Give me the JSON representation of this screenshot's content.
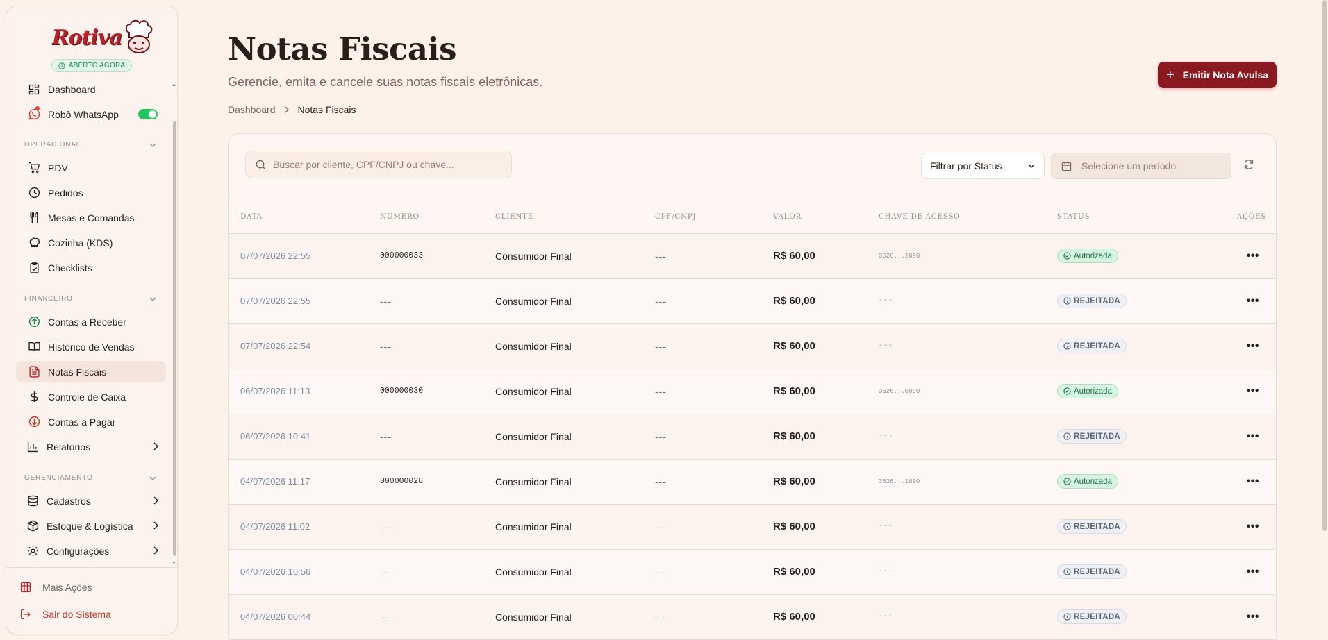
{
  "brand": {
    "logo_text": "Rotiva",
    "open_badge": "ABERTO AGORA",
    "brand_color": "#b5232a"
  },
  "sidebar": {
    "top_items": [
      {
        "label": "Dashboard",
        "icon": "dashboard-icon"
      },
      {
        "label": "Robô WhatsApp",
        "icon": "whatsapp-icon",
        "toggle_on": true
      }
    ],
    "sections": [
      {
        "title": "OPERACIONAL",
        "items": [
          {
            "label": "PDV",
            "icon": "cart-icon"
          },
          {
            "label": "Pedidos",
            "icon": "clock-icon"
          },
          {
            "label": "Mesas e Comandas",
            "icon": "utensils-icon"
          },
          {
            "label": "Cozinha (KDS)",
            "icon": "chef-hat-icon"
          },
          {
            "label": "Checklists",
            "icon": "clipboard-check-icon"
          }
        ]
      },
      {
        "title": "FINANCEIRO",
        "items": [
          {
            "label": "Contas a Receber",
            "icon": "arrow-up-circle-icon"
          },
          {
            "label": "Histórico de Vendas",
            "icon": "book-icon"
          },
          {
            "label": "Notas Fiscais",
            "icon": "file-text-icon",
            "active": true
          },
          {
            "label": "Controle de Caixa",
            "icon": "dollar-icon"
          },
          {
            "label": "Contas a Pagar",
            "icon": "arrow-down-circle-icon"
          },
          {
            "label": "Relatórios",
            "icon": "bar-chart-icon",
            "has_submenu": true
          }
        ]
      },
      {
        "title": "GERENCIAMENTO",
        "items": [
          {
            "label": "Cadastros",
            "icon": "database-icon",
            "has_submenu": true
          },
          {
            "label": "Estoque & Logística",
            "icon": "package-icon",
            "has_submenu": true
          },
          {
            "label": "Configurações",
            "icon": "gear-icon",
            "has_submenu": true
          }
        ]
      }
    ],
    "footer": {
      "more_actions": "Mais Ações",
      "logout": "Sair do Sistema"
    }
  },
  "header": {
    "title": "Notas Fiscais",
    "subtitle": "Gerencie, emita e cancele suas notas fiscais eletrônicas.",
    "breadcrumb": [
      "Dashboard",
      "Notas Fiscais"
    ],
    "emit_button": "Emitir Nota Avulsa"
  },
  "toolbar": {
    "search_placeholder": "Buscar por cliente, CPF/CNPJ ou chave...",
    "status_filter": "Filtrar por Status",
    "date_placeholder": "Selecione um período"
  },
  "table": {
    "columns": [
      "DATA",
      "NÚMERO",
      "CLIENTE",
      "CPF/CNPJ",
      "VALOR",
      "CHAVE DE ACESSO",
      "STATUS",
      "AÇÕES"
    ],
    "rows": [
      {
        "data": "07/07/2026 22:55",
        "numero": "000000033",
        "cliente": "Consumidor Final",
        "cpf": "---",
        "valor": "R$ 60,00",
        "chave": "3526...2090",
        "status": "Autorizada"
      },
      {
        "data": "07/07/2026 22:55",
        "numero": "---",
        "cliente": "Consumidor Final",
        "cpf": "---",
        "valor": "R$ 60,00",
        "chave": "---",
        "status": "REJEITADA"
      },
      {
        "data": "07/07/2026 22:54",
        "numero": "---",
        "cliente": "Consumidor Final",
        "cpf": "---",
        "valor": "R$ 60,00",
        "chave": "---",
        "status": "REJEITADA"
      },
      {
        "data": "06/07/2026 11:13",
        "numero": "000000030",
        "cliente": "Consumidor Final",
        "cpf": "---",
        "valor": "R$ 60,00",
        "chave": "3526...0090",
        "status": "Autorizada"
      },
      {
        "data": "06/07/2026 10:41",
        "numero": "---",
        "cliente": "Consumidor Final",
        "cpf": "---",
        "valor": "R$ 60,00",
        "chave": "---",
        "status": "REJEITADA"
      },
      {
        "data": "04/07/2026 11:17",
        "numero": "000000028",
        "cliente": "Consumidor Final",
        "cpf": "---",
        "valor": "R$ 60,00",
        "chave": "3526...1890",
        "status": "Autorizada"
      },
      {
        "data": "04/07/2026 11:02",
        "numero": "---",
        "cliente": "Consumidor Final",
        "cpf": "---",
        "valor": "R$ 60,00",
        "chave": "---",
        "status": "REJEITADA"
      },
      {
        "data": "04/07/2026 10:56",
        "numero": "---",
        "cliente": "Consumidor Final",
        "cpf": "---",
        "valor": "R$ 60,00",
        "chave": "---",
        "status": "REJEITADA"
      },
      {
        "data": "04/07/2026 00:44",
        "numero": "---",
        "cliente": "Consumidor Final",
        "cpf": "---",
        "valor": "R$ 60,00",
        "chave": "---",
        "status": "REJEITADA"
      }
    ]
  },
  "colors": {
    "primary": "#8a1a1f",
    "background": "#fdf1ea",
    "authorized": "#197a43",
    "rejected": "#5b6577"
  }
}
